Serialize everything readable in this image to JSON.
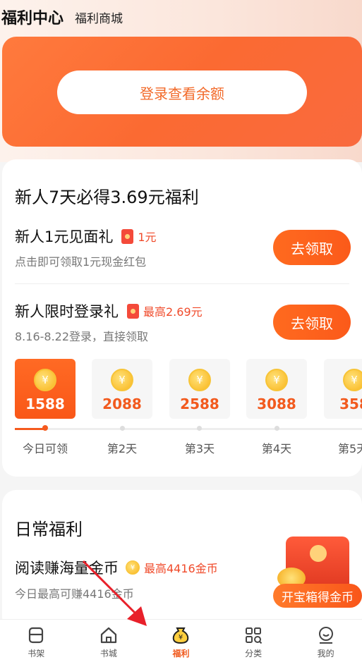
{
  "header": {
    "title": "福利中心",
    "subtitle": "福利商城"
  },
  "balance": {
    "login_label": "登录查看余额"
  },
  "newbie": {
    "title": "新人7天必得3.69元福利",
    "gift1": {
      "title": "新人1元见面礼",
      "reward": "1元",
      "desc": "点击即可领取1元现金红包",
      "button": "去领取"
    },
    "gift2": {
      "title": "新人限时登录礼",
      "reward": "最高2.69元",
      "desc": "8.16-8.22登录，直接领取",
      "button": "去领取"
    },
    "days": [
      {
        "amount": "1588",
        "label": "今日可领",
        "active": true
      },
      {
        "amount": "2088",
        "label": "第2天"
      },
      {
        "amount": "2588",
        "label": "第3天"
      },
      {
        "amount": "3088",
        "label": "第4天"
      },
      {
        "amount": "358",
        "label": "第5天"
      }
    ]
  },
  "daily": {
    "title": "日常福利",
    "read": {
      "title": "阅读赚海量金币",
      "reward": "最高4416金币",
      "desc": "今日最高可赚4416金币"
    },
    "chest_button": "开宝箱得金币"
  },
  "tabbar": [
    {
      "label": "书架",
      "icon": "bookshelf-icon"
    },
    {
      "label": "书城",
      "icon": "home-icon"
    },
    {
      "label": "福利",
      "icon": "money-bag-icon",
      "active": true
    },
    {
      "label": "分类",
      "icon": "category-icon"
    },
    {
      "label": "我的",
      "icon": "profile-icon"
    }
  ],
  "colors": {
    "accent": "#f55a1e",
    "annotation_arrow": "#e8202a"
  }
}
